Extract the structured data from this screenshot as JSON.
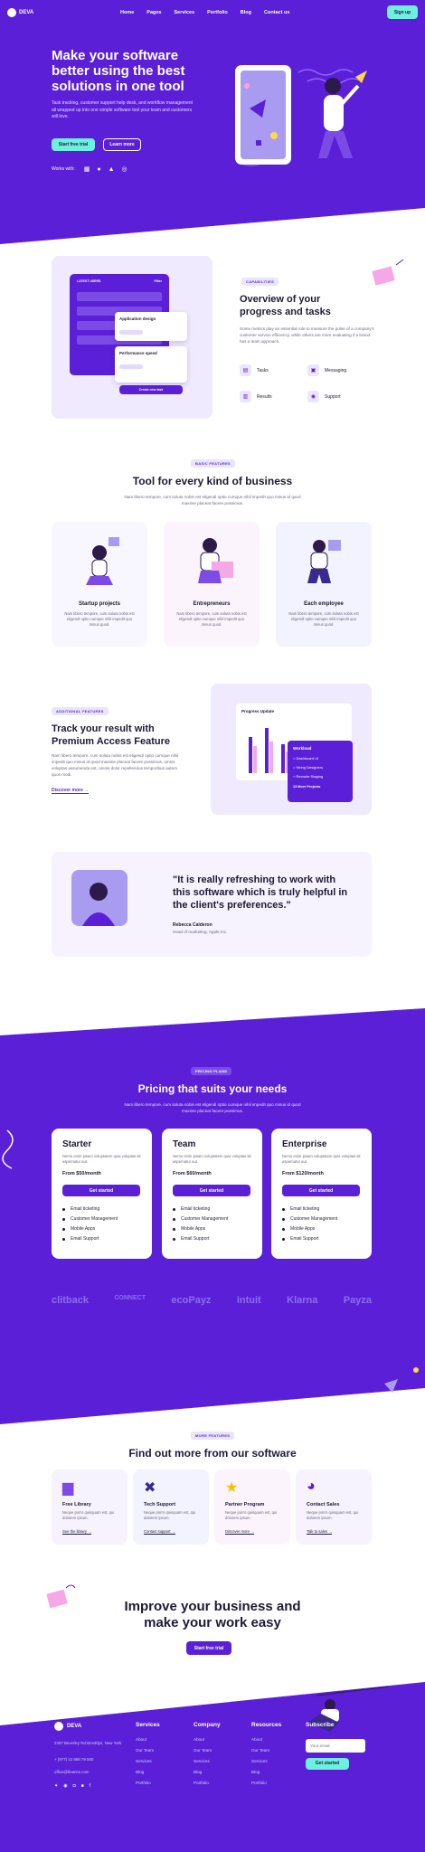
{
  "nav": {
    "logo": "DEVA",
    "items": [
      "Home",
      "Pages",
      "Services",
      "Portfolio",
      "Blog",
      "Contact us"
    ],
    "signup": "Sign up"
  },
  "hero": {
    "title": "Make your software better using the best solutions in one tool",
    "text": "Task tracking, customer support help desk, and workflow management all wrapped up into one simple software tool your team and customers will love.",
    "primary": "Start free trial",
    "secondary": "Learn more",
    "works_with": "Works with:"
  },
  "overview": {
    "tag": "CAPABILITIES",
    "title": "Overview of your progress and tasks",
    "text": "Some metrics play an essential role to measure the pulse of a company's customer service efficiency, while others are more evaluating if a brand has a team approach.",
    "features": [
      "Tasks",
      "Messaging",
      "Results",
      "Support"
    ],
    "mock": {
      "header": "LATEST USERS",
      "filter": "Filter",
      "card1": "Application design",
      "card2": "Performance speed",
      "btn": "Create new task"
    }
  },
  "tools": {
    "tag": "BASIC FEATURES",
    "title": "Tool for every kind of business",
    "text": "Nam libero tempore, cum soluta nobis est eligendi optio cumque nihil impedit quo minus id quod maxime placeat facere possimus.",
    "cards": [
      {
        "title": "Startup projects",
        "text": "Nam libero tempore, cum soluta nobis est eligendi optio cumque nihil impedit quo minus quod."
      },
      {
        "title": "Entrepreneurs",
        "text": "Nam libero tempore, cum soluta nobis est eligendi optio cumque nihil impedit quo minus quod."
      },
      {
        "title": "Each employee",
        "text": "Nam libero tempore, cum soluta nobis est eligendi optio cumque nihil impedit quo minus quod."
      }
    ]
  },
  "premium": {
    "tag": "ADDITIONAL FEATURES",
    "title": "Track your result with Premium Access Feature",
    "text": "Nam libero tempore, cum soluta nobis est eligendi optio cumque nihil impedit quo minus id quod maxime placeat facere possimus, omnis voluptas assumenda est, omnis dolor repellendus temporibus autem quos modi.",
    "link": "Discover more",
    "chart_title": "Progress Update",
    "workload": {
      "title": "Workload",
      "items": [
        "Dashboard UI",
        "Hiring Designers",
        "Recruite Staging"
      ],
      "footer": "13 More Projects"
    }
  },
  "testimonial": {
    "quote": "\"It is really refreshing to work with this software which is truly helpful in the client's preferences.\"",
    "name": "Rebecca Calderon",
    "role": "Head of marketing, Apple Inc."
  },
  "pricing": {
    "tag": "PRICING PLANS",
    "title": "Pricing that suits your needs",
    "text": "Nam libero tempore, cum soluta nobis est eligendi optio cumque nihil impedit quo minus id quod maxime placeat facere possimus.",
    "plans": [
      {
        "name": "Starter",
        "desc": "Nemo enim ipsam voluptatem quia voluptas sit aspernatur aut.",
        "price": "From $50/month",
        "cta": "Get started"
      },
      {
        "name": "Team",
        "desc": "Nemo enim ipsam voluptatem quia voluptas sit aspernatur aut.",
        "price": "From $60/month",
        "cta": "Get started"
      },
      {
        "name": "Enterprise",
        "desc": "Nemo enim ipsam voluptatem quia voluptas sit aspernatur aut.",
        "price": "From $120/month",
        "cta": "Get started"
      }
    ],
    "features": [
      "Email ticketing",
      "Customer Management",
      "Mobile Apps",
      "Email Support"
    ],
    "logos": [
      "clitback",
      "CONNECT",
      "ecoPayz",
      "intuit",
      "Klarna",
      "Payza"
    ]
  },
  "more": {
    "tag": "MORE FEATURES",
    "title": "Find out more from our software",
    "cards": [
      {
        "title": "Free Library",
        "text": "Neque porro quisquam est, qui dolorem ipsum.",
        "link": "See the library"
      },
      {
        "title": "Tech Support",
        "text": "Neque porro quisquam est, qui dolorem ipsum.",
        "link": "Contact support"
      },
      {
        "title": "Partner Program",
        "text": "Neque porro quisquam est, qui dolorem ipsum.",
        "link": "Discover more"
      },
      {
        "title": "Contact Sales",
        "text": "Neque porro quisquam est, qui dolorem ipsum.",
        "link": "Talk to sales"
      }
    ]
  },
  "cta": {
    "title": "Improve your business and make your work easy",
    "button": "Start free trial"
  },
  "footer": {
    "logo": "DEVA",
    "address": "2307 Beverley Rd Brooklyn, New York",
    "phone": "+ (977) 12 858 79 500",
    "email": "office@finance.com",
    "columns": [
      {
        "title": "Services",
        "items": [
          "About",
          "Our Team",
          "Services",
          "Blog",
          "Portfolio"
        ]
      },
      {
        "title": "Company",
        "items": [
          "About",
          "Our Team",
          "Services",
          "Blog",
          "Portfolio"
        ]
      },
      {
        "title": "Resources",
        "items": [
          "About",
          "Our Team",
          "Services",
          "Blog",
          "Portfolio"
        ]
      }
    ],
    "subscribe": {
      "title": "Subscribe",
      "placeholder": "Your email",
      "button": "Get started"
    }
  }
}
